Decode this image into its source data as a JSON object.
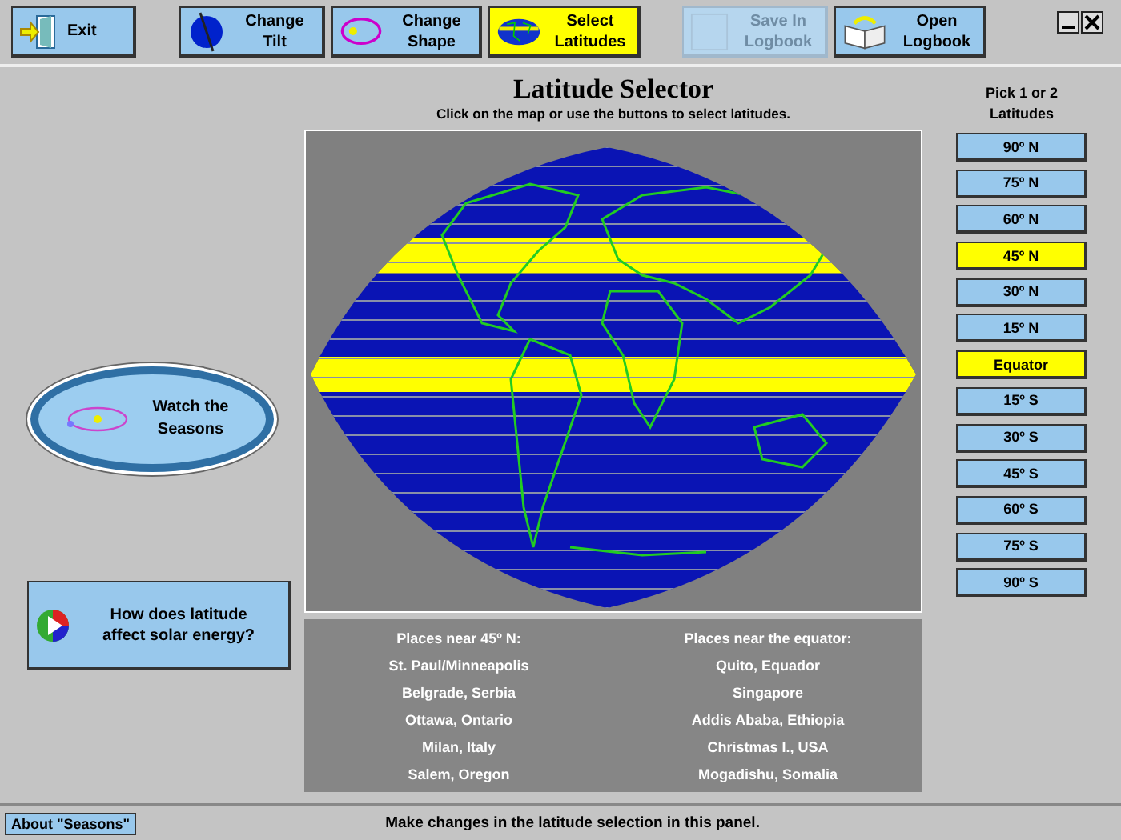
{
  "toolbar": [
    {
      "kind": "exit",
      "label": "Exit",
      "selected": false,
      "disabled": false
    },
    {
      "kind": "tilt",
      "label": "Change Tilt",
      "selected": false,
      "disabled": false
    },
    {
      "kind": "shape",
      "label": "Change Shape",
      "selected": false,
      "disabled": false
    },
    {
      "kind": "latitudes",
      "label": "Select Latitudes",
      "selected": true,
      "disabled": false
    },
    {
      "kind": "save",
      "label": "Save In Logbook",
      "selected": false,
      "disabled": true
    },
    {
      "kind": "logbook",
      "label": "Open Logbook",
      "selected": false,
      "disabled": false
    }
  ],
  "title": "Latitude Selector",
  "subtitle": "Click on the map or use the buttons to select latitudes.",
  "watch_button": {
    "label": "Watch the Seasons"
  },
  "solar_button": {
    "label": "How does latitude affect solar energy?"
  },
  "latitude_picker": {
    "heading": "Pick 1 or 2 Latitudes",
    "options": [
      {
        "label": "90º N",
        "selected": false
      },
      {
        "label": "75º N",
        "selected": false
      },
      {
        "label": "60º N",
        "selected": false
      },
      {
        "label": "45º N",
        "selected": true
      },
      {
        "label": "30º N",
        "selected": false
      },
      {
        "label": "15º N",
        "selected": false
      },
      {
        "label": "Equator",
        "selected": true
      },
      {
        "label": "15º S",
        "selected": false
      },
      {
        "label": "30º S",
        "selected": false
      },
      {
        "label": "45º S",
        "selected": false
      },
      {
        "label": "60º S",
        "selected": false
      },
      {
        "label": "75º S",
        "selected": false
      },
      {
        "label": "90º S",
        "selected": false
      }
    ]
  },
  "places": [
    {
      "heading": "Places near 45º N:",
      "items": [
        "St. Paul/Minneapolis",
        "Belgrade, Serbia",
        "Ottawa, Ontario",
        "Milan, Italy",
        "Salem, Oregon"
      ]
    },
    {
      "heading": "Places near the equator:",
      "items": [
        "Quito, Equador",
        "Singapore",
        "Addis Ababa, Ethiopia",
        "Christmas I., USA",
        "Mogadishu, Somalia"
      ]
    }
  ],
  "about_button": "About \"Seasons\"",
  "status_bar": "Make changes in the latitude selection in this panel."
}
